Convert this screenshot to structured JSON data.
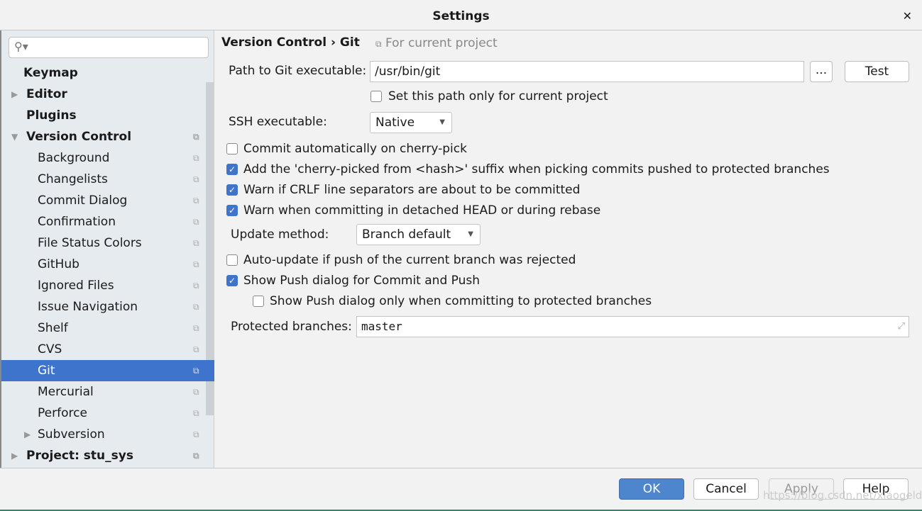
{
  "title": "Settings",
  "search": {
    "placeholder": ""
  },
  "sidebar": {
    "items": [
      {
        "label": "Keymap",
        "bold": true,
        "indent": 0
      },
      {
        "label": "Editor",
        "bold": true,
        "indent": 0,
        "arrow": "collapsed"
      },
      {
        "label": "Plugins",
        "bold": true,
        "indent": 0
      },
      {
        "label": "Version Control",
        "bold": true,
        "indent": 0,
        "arrow": "expanded",
        "copy": true
      },
      {
        "label": "Background",
        "indent": 1,
        "copy": true
      },
      {
        "label": "Changelists",
        "indent": 1,
        "copy": true
      },
      {
        "label": "Commit Dialog",
        "indent": 1,
        "copy": true
      },
      {
        "label": "Confirmation",
        "indent": 1,
        "copy": true
      },
      {
        "label": "File Status Colors",
        "indent": 1,
        "copy": true
      },
      {
        "label": "GitHub",
        "indent": 1,
        "copy": true
      },
      {
        "label": "Ignored Files",
        "indent": 1,
        "copy": true
      },
      {
        "label": "Issue Navigation",
        "indent": 1,
        "copy": true
      },
      {
        "label": "Shelf",
        "indent": 1,
        "copy": true
      },
      {
        "label": "CVS",
        "indent": 1,
        "copy": true
      },
      {
        "label": "Git",
        "indent": 1,
        "copy": true,
        "selected": true
      },
      {
        "label": "Mercurial",
        "indent": 1,
        "copy": true
      },
      {
        "label": "Perforce",
        "indent": 1,
        "copy": true
      },
      {
        "label": "Subversion",
        "indent": 1,
        "copy": true,
        "arrow": "collapsed"
      },
      {
        "label": "Project: stu_sys",
        "bold": true,
        "indent": 0,
        "arrow": "collapsed",
        "copy": true
      }
    ]
  },
  "breadcrumb": {
    "parent": "Version Control",
    "sep": "›",
    "current": "Git",
    "scope": "For current project"
  },
  "git": {
    "path_label": "Path to Git executable:",
    "path_value": "/usr/bin/git",
    "browse": "...",
    "test": "Test",
    "path_only_current": {
      "label": "Set this path only for current project",
      "checked": false
    },
    "ssh_label": "SSH executable:",
    "ssh_value": "Native",
    "options": [
      {
        "label": "Commit automatically on cherry-pick",
        "checked": false
      },
      {
        "label": "Add the 'cherry-picked from <hash>' suffix when picking commits pushed to protected branches",
        "checked": true
      },
      {
        "label": "Warn if CRLF line separators are about to be committed",
        "checked": true
      },
      {
        "label": "Warn when committing in detached HEAD or during rebase",
        "checked": true
      }
    ],
    "update_label": "Update method:",
    "update_value": "Branch default",
    "autoupdate": {
      "label": "Auto-update if push of the current branch was rejected",
      "checked": false
    },
    "showpush": {
      "label": "Show Push dialog for Commit and Push",
      "checked": true
    },
    "showpush_protected": {
      "label": "Show Push dialog only when committing to protected branches",
      "checked": false
    },
    "protected_label": "Protected branches:",
    "protected_value": "master"
  },
  "footer": {
    "ok": "OK",
    "cancel": "Cancel",
    "apply": "Apply",
    "help": "Help"
  },
  "watermark": "https://blog.csdn.net/xiaogeldx",
  "colors": {
    "accent": "#3e74cc"
  }
}
